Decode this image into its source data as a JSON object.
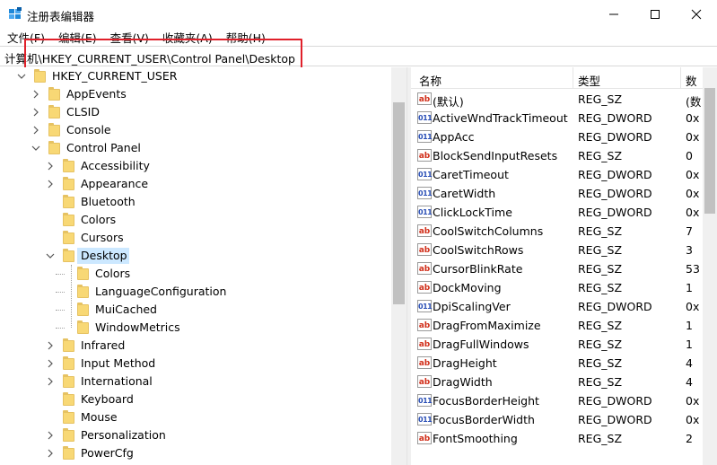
{
  "window": {
    "title": "注册表编辑器",
    "minimize_glyph": "—",
    "maximize_glyph": "☐",
    "close_glyph": "✕"
  },
  "menu": [
    {
      "label": "文件(F)"
    },
    {
      "label": "编辑(E)"
    },
    {
      "label": "查看(V)"
    },
    {
      "label": "收藏夹(A)"
    },
    {
      "label": "帮助(H)"
    }
  ],
  "address": {
    "path": "计算机\\HKEY_CURRENT_USER\\Control Panel\\Desktop",
    "highlight_color": "#e0202a"
  },
  "tree": {
    "items": [
      {
        "label": "HKEY_CURRENT_USER",
        "depth": 0,
        "expander": "expanded"
      },
      {
        "label": "AppEvents",
        "depth": 1,
        "expander": "collapsed"
      },
      {
        "label": "CLSID",
        "depth": 1,
        "expander": "collapsed"
      },
      {
        "label": "Console",
        "depth": 1,
        "expander": "collapsed"
      },
      {
        "label": "Control Panel",
        "depth": 1,
        "expander": "expanded"
      },
      {
        "label": "Accessibility",
        "depth": 2,
        "expander": "collapsed"
      },
      {
        "label": "Appearance",
        "depth": 2,
        "expander": "collapsed"
      },
      {
        "label": "Bluetooth",
        "depth": 2,
        "expander": "none"
      },
      {
        "label": "Colors",
        "depth": 2,
        "expander": "none"
      },
      {
        "label": "Cursors",
        "depth": 2,
        "expander": "none"
      },
      {
        "label": "Desktop",
        "depth": 2,
        "expander": "expanded",
        "selected": true
      },
      {
        "label": "Colors",
        "depth": 3,
        "expander": "none"
      },
      {
        "label": "LanguageConfiguration",
        "depth": 3,
        "expander": "none"
      },
      {
        "label": "MuiCached",
        "depth": 3,
        "expander": "none"
      },
      {
        "label": "WindowMetrics",
        "depth": 3,
        "expander": "none"
      },
      {
        "label": "Infrared",
        "depth": 2,
        "expander": "collapsed"
      },
      {
        "label": "Input Method",
        "depth": 2,
        "expander": "collapsed"
      },
      {
        "label": "International",
        "depth": 2,
        "expander": "collapsed"
      },
      {
        "label": "Keyboard",
        "depth": 2,
        "expander": "none"
      },
      {
        "label": "Mouse",
        "depth": 2,
        "expander": "none"
      },
      {
        "label": "Personalization",
        "depth": 2,
        "expander": "collapsed"
      },
      {
        "label": "PowerCfg",
        "depth": 2,
        "expander": "collapsed"
      }
    ],
    "selection_color": "#cce8ff"
  },
  "list": {
    "columns": [
      {
        "label": "名称"
      },
      {
        "label": "类型"
      },
      {
        "label": "数"
      }
    ],
    "rows": [
      {
        "name": "(默认)",
        "type": "REG_SZ",
        "data": "(数",
        "icon": "string-value-icon"
      },
      {
        "name": "ActiveWndTrackTimeout",
        "type": "REG_DWORD",
        "data": "0x",
        "icon": "dword-value-icon"
      },
      {
        "name": "AppAcc",
        "type": "REG_DWORD",
        "data": "0x",
        "icon": "dword-value-icon"
      },
      {
        "name": "BlockSendInputResets",
        "type": "REG_SZ",
        "data": "0",
        "icon": "string-value-icon"
      },
      {
        "name": "CaretTimeout",
        "type": "REG_DWORD",
        "data": "0x",
        "icon": "dword-value-icon"
      },
      {
        "name": "CaretWidth",
        "type": "REG_DWORD",
        "data": "0x",
        "icon": "dword-value-icon"
      },
      {
        "name": "ClickLockTime",
        "type": "REG_DWORD",
        "data": "0x",
        "icon": "dword-value-icon"
      },
      {
        "name": "CoolSwitchColumns",
        "type": "REG_SZ",
        "data": "7",
        "icon": "string-value-icon"
      },
      {
        "name": "CoolSwitchRows",
        "type": "REG_SZ",
        "data": "3",
        "icon": "string-value-icon"
      },
      {
        "name": "CursorBlinkRate",
        "type": "REG_SZ",
        "data": "53",
        "icon": "string-value-icon"
      },
      {
        "name": "DockMoving",
        "type": "REG_SZ",
        "data": "1",
        "icon": "string-value-icon"
      },
      {
        "name": "DpiScalingVer",
        "type": "REG_DWORD",
        "data": "0x",
        "icon": "dword-value-icon"
      },
      {
        "name": "DragFromMaximize",
        "type": "REG_SZ",
        "data": "1",
        "icon": "string-value-icon"
      },
      {
        "name": "DragFullWindows",
        "type": "REG_SZ",
        "data": "1",
        "icon": "string-value-icon"
      },
      {
        "name": "DragHeight",
        "type": "REG_SZ",
        "data": "4",
        "icon": "string-value-icon"
      },
      {
        "name": "DragWidth",
        "type": "REG_SZ",
        "data": "4",
        "icon": "string-value-icon"
      },
      {
        "name": "FocusBorderHeight",
        "type": "REG_DWORD",
        "data": "0x",
        "icon": "dword-value-icon"
      },
      {
        "name": "FocusBorderWidth",
        "type": "REG_DWORD",
        "data": "0x",
        "icon": "dword-value-icon"
      },
      {
        "name": "FontSmoothing",
        "type": "REG_SZ",
        "data": "2",
        "icon": "string-value-icon"
      }
    ],
    "icon_glyphs": {
      "string": "ab",
      "dword": "011"
    }
  }
}
